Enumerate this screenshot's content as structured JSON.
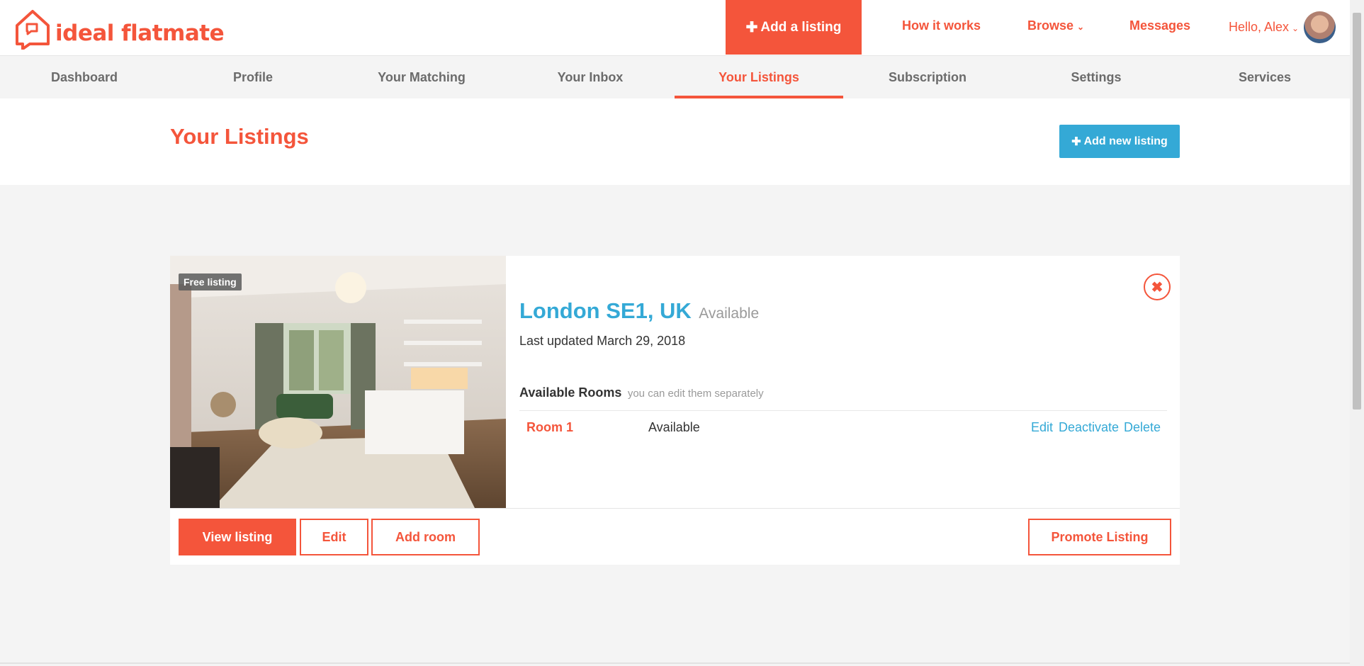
{
  "brand": {
    "name": "ideal flatmate",
    "accent": "#f4553b",
    "blue": "#34a9d6"
  },
  "header": {
    "add_listing": "Add a listing",
    "how_it_works": "How it works",
    "browse": "Browse",
    "messages": "Messages",
    "greeting": "Hello, Alex"
  },
  "tabs": [
    {
      "label": "Dashboard"
    },
    {
      "label": "Profile"
    },
    {
      "label": "Your Matching"
    },
    {
      "label": "Your Inbox"
    },
    {
      "label": "Your Listings",
      "active": true
    },
    {
      "label": "Subscription"
    },
    {
      "label": "Settings"
    },
    {
      "label": "Services"
    }
  ],
  "page": {
    "title": "Your Listings",
    "add_new_listing": "Add new listing"
  },
  "listing": {
    "badge": "Free listing",
    "location": "London SE1, UK",
    "status": "Available",
    "last_updated": "Last updated March 29, 2018",
    "rooms_heading": "Available Rooms",
    "rooms_subheading": "you can edit them separately",
    "rooms": [
      {
        "name": "Room 1",
        "status": "Available",
        "edit": "Edit",
        "deactivate": "Deactivate",
        "delete": "Delete"
      }
    ],
    "buttons": {
      "view": "View listing",
      "edit": "Edit",
      "add_room": "Add room",
      "promote": "Promote Listing"
    }
  }
}
